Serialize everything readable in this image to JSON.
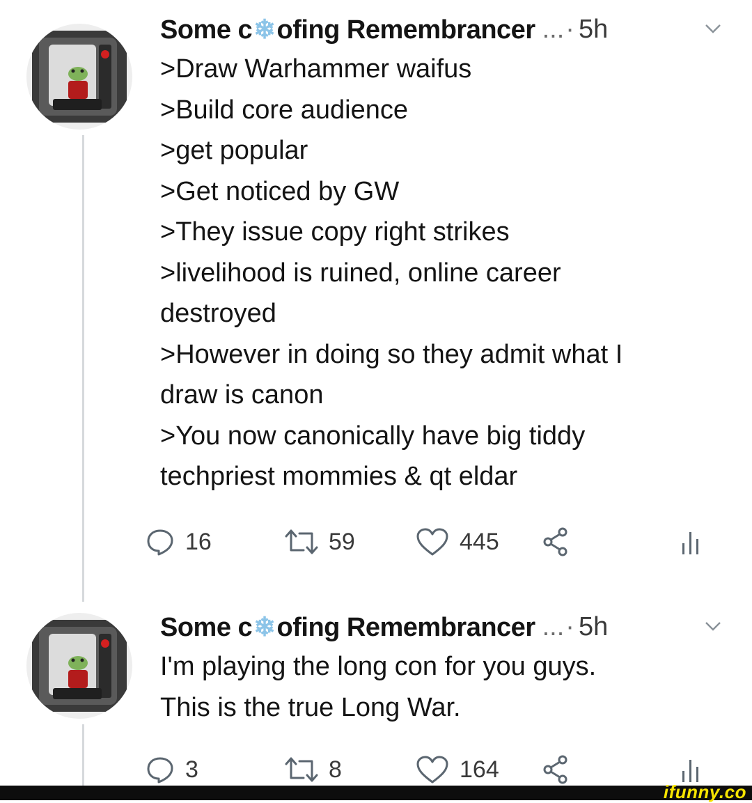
{
  "tweets": [
    {
      "name_prefix": "Some c",
      "name_suffix": "ofing Remembrancer",
      "ellipsis": "...",
      "separator": "·",
      "time": "5h",
      "lines": [
        ">Draw Warhammer waifus",
        ">Build core audience",
        ">get popular",
        ">Get noticed by GW",
        ">They issue copy right strikes",
        ">livelihood is ruined, online career",
        "destroyed",
        ">However in doing so they admit what I",
        "draw is canon",
        ">You now canonically have big tiddy",
        "techpriest mommies & qt eldar"
      ],
      "replies": "16",
      "retweets": "59",
      "likes": "445"
    },
    {
      "name_prefix": "Some c",
      "name_suffix": "ofing Remembrancer",
      "ellipsis": "...",
      "separator": "·",
      "time": "5h",
      "lines": [
        "I'm playing the long con for you guys.",
        "This is the true Long War."
      ],
      "replies": "3",
      "retweets": "8",
      "likes": "164"
    }
  ],
  "icons": {
    "reply": "speech-bubble-icon",
    "retweet": "retweet-icon",
    "like": "heart-icon",
    "share": "share-icon",
    "stats": "bar-stats-icon",
    "name_emoji": "snowflake-icon",
    "menu": "chevron-down-icon"
  },
  "colors": {
    "text": "#141414",
    "icon": "#5b6670",
    "snowflake": "#8cc4e8",
    "thread_line": "#d6d9dc",
    "watermark": "#f7e400"
  },
  "watermark": "ifunny.co"
}
